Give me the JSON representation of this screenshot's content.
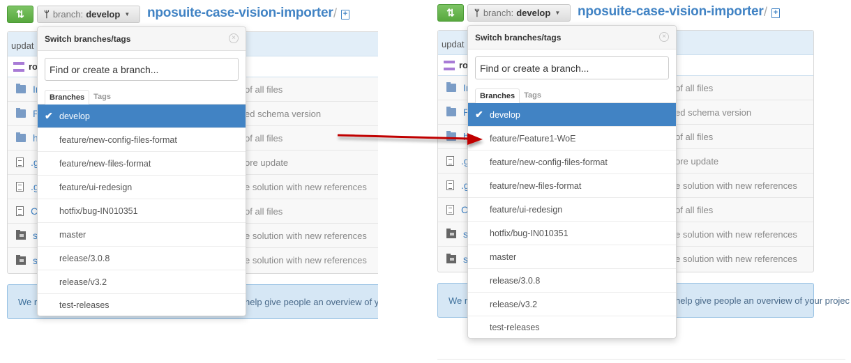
{
  "colors": {
    "accent": "#4183c4",
    "compare_green": "#6cba51",
    "selected_bg": "#4183c4",
    "table_header_bg": "#e2eef8",
    "banner_bg": "#d6e7f5",
    "arrow": "#c00000"
  },
  "panels": [
    {
      "id": "before",
      "compare_icon": "compare-arrows-icon",
      "branch_button": {
        "icon": "git-branch-icon",
        "label": "branch:",
        "name": "develop",
        "caret": "▼"
      },
      "repo_title": "nposuite-case-vision-importer",
      "repo_slash": "/",
      "new_file_icon": "+",
      "table": {
        "header_fragment": "updat",
        "committer_fragment": "ro",
        "rows": [
          {
            "type": "folder",
            "name_fragment": "In",
            "message_fragment": "of all files"
          },
          {
            "type": "folder",
            "name_fragment": "P",
            "message_fragment": "ed schema version"
          },
          {
            "type": "folder",
            "name_fragment": "h",
            "message_fragment": "of all files"
          },
          {
            "type": "file",
            "name_fragment": ".g",
            "message_fragment": "ore update"
          },
          {
            "type": "file",
            "name_fragment": ".g",
            "message_fragment": "e solution with new references"
          },
          {
            "type": "file",
            "name_fragment": "C",
            "message_fragment": "of all files"
          },
          {
            "type": "submodule",
            "name_fragment": "s",
            "message_fragment": "e solution with new references"
          },
          {
            "type": "submodule",
            "name_fragment": "s",
            "message_fragment": "e solution with new references"
          }
        ]
      },
      "readme_banner": {
        "start": "We r",
        "tail": "help give people an overview of yo"
      },
      "dropdown": {
        "title": "Switch branches/tags",
        "close_icon": "⊗",
        "search_placeholder": "Find or create a branch...",
        "tabs": [
          "Branches",
          "Tags"
        ],
        "active_tab": "Branches",
        "items": [
          {
            "label": "develop",
            "selected": true
          },
          {
            "label": "feature/new-config-files-format",
            "selected": false
          },
          {
            "label": "feature/new-files-format",
            "selected": false
          },
          {
            "label": "feature/ui-redesign",
            "selected": false
          },
          {
            "label": "hotfix/bug-IN010351",
            "selected": false
          },
          {
            "label": "master",
            "selected": false
          },
          {
            "label": "release/3.0.8",
            "selected": false
          },
          {
            "label": "release/v3.2",
            "selected": false
          },
          {
            "label": "test-releases",
            "selected": false
          }
        ]
      }
    },
    {
      "id": "after",
      "compare_icon": "compare-arrows-icon",
      "branch_button": {
        "icon": "git-branch-icon",
        "label": "branch:",
        "name": "develop",
        "caret": "▼"
      },
      "repo_title": "nposuite-case-vision-importer",
      "repo_slash": "/",
      "new_file_icon": "+",
      "table": {
        "header_fragment": "updat",
        "committer_fragment": "ro",
        "rows": [
          {
            "type": "folder",
            "name_fragment": "In",
            "message_fragment": "of all files"
          },
          {
            "type": "folder",
            "name_fragment": "P",
            "message_fragment": "ed schema version"
          },
          {
            "type": "folder",
            "name_fragment": "h",
            "message_fragment": "of all files"
          },
          {
            "type": "file",
            "name_fragment": ".g",
            "message_fragment": "ore update"
          },
          {
            "type": "file",
            "name_fragment": ".g",
            "message_fragment": "e solution with new references"
          },
          {
            "type": "file",
            "name_fragment": "C",
            "message_fragment": "of all files"
          },
          {
            "type": "submodule",
            "name_fragment": "s",
            "message_fragment": "e solution with new references"
          },
          {
            "type": "submodule",
            "name_fragment": "s",
            "message_fragment": "e solution with new references"
          }
        ]
      },
      "readme_banner": {
        "start": "We r",
        "tail": "help give people an overview of your projec"
      },
      "dropdown": {
        "title": "Switch branches/tags",
        "close_icon": "⊗",
        "search_placeholder": "Find or create a branch...",
        "tabs": [
          "Branches",
          "Tags"
        ],
        "active_tab": "Branches",
        "items": [
          {
            "label": "develop",
            "selected": true
          },
          {
            "label": "feature/Feature1-WoE",
            "selected": false
          },
          {
            "label": "feature/new-config-files-format",
            "selected": false
          },
          {
            "label": "feature/new-files-format",
            "selected": false
          },
          {
            "label": "feature/ui-redesign",
            "selected": false
          },
          {
            "label": "hotfix/bug-IN010351",
            "selected": false
          },
          {
            "label": "master",
            "selected": false
          },
          {
            "label": "release/3.0.8",
            "selected": false
          },
          {
            "label": "release/v3.2",
            "selected": false
          },
          {
            "label": "test-releases",
            "selected": false
          }
        ]
      }
    }
  ],
  "annotation": {
    "type": "arrow",
    "points_to": "feature/Feature1-WoE"
  }
}
